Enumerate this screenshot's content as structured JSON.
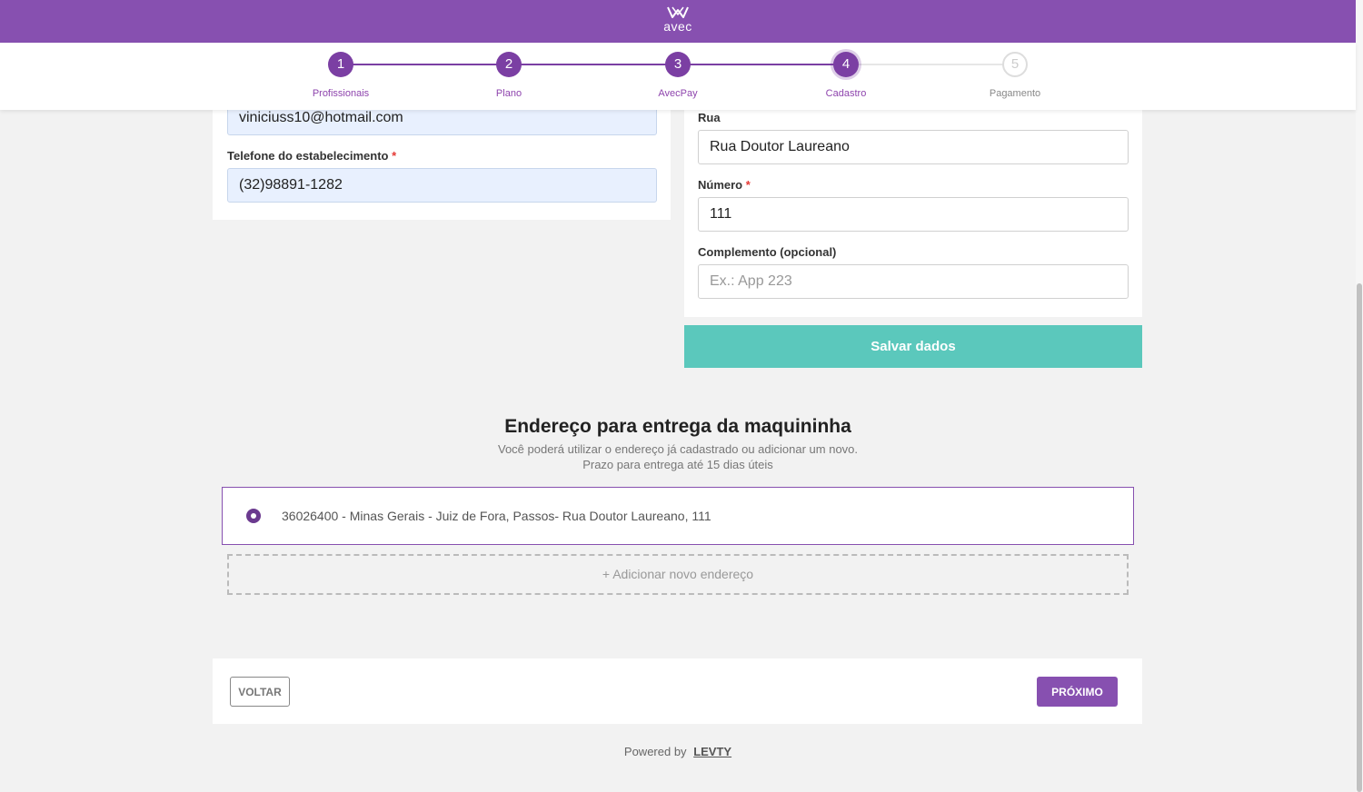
{
  "header": {
    "logo_text": "avec"
  },
  "stepper": {
    "steps": [
      {
        "number": "1",
        "label": "Profissionais",
        "state": "done"
      },
      {
        "number": "2",
        "label": "Plano",
        "state": "done"
      },
      {
        "number": "3",
        "label": "AvecPay",
        "state": "done"
      },
      {
        "number": "4",
        "label": "Cadastro",
        "state": "active"
      },
      {
        "number": "5",
        "label": "Pagamento",
        "state": "pending"
      }
    ]
  },
  "left_form": {
    "email_value": "viniciuss10@hotmail.com",
    "phone_label": "Telefone do estabelecimento",
    "phone_value": "(32)98891-1282"
  },
  "right_form": {
    "street_label": "Rua",
    "street_value": "Rua Doutor Laureano",
    "number_label": "Número",
    "number_value": "111",
    "complement_label": "Complemento (opcional)",
    "complement_placeholder": "Ex.: App 223",
    "save_button": "Salvar dados"
  },
  "required_marker": "*",
  "delivery": {
    "title": "Endereço para entrega da maquininha",
    "subtitle_line1": "Você poderá utilizar o endereço já cadastrado ou adicionar um novo.",
    "subtitle_line2": "Prazo para entrega até 15 dias úteis",
    "address_option": "36026400 - Minas Gerais - Juiz de Fora, Passos- Rua Doutor Laureano, 111",
    "add_address": "+ Adicionar novo endereço"
  },
  "footer": {
    "back_button": "VOLTAR",
    "next_button": "PRÓXIMO",
    "powered_by": "Powered by",
    "brand": "LEVTY"
  },
  "colors": {
    "primary": "#8750b0",
    "teal": "#5bc8bc",
    "autofill": "#e8f0fe"
  }
}
